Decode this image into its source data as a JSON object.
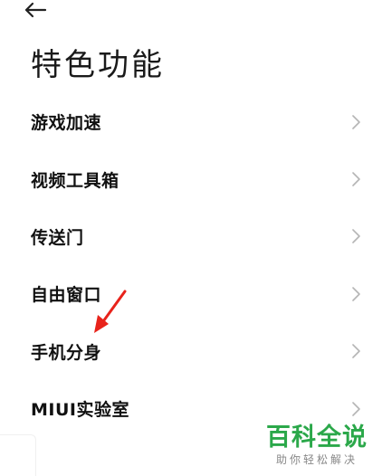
{
  "header": {
    "back_icon": "arrow-left-icon",
    "title": "特色功能"
  },
  "list": {
    "items": [
      {
        "label": "游戏加速",
        "icon": "chevron-right-icon"
      },
      {
        "label": "视频工具箱",
        "icon": "chevron-right-icon"
      },
      {
        "label": "传送门",
        "icon": "chevron-right-icon"
      },
      {
        "label": "自由窗口",
        "icon": "chevron-right-icon"
      },
      {
        "label": "手机分身",
        "icon": "chevron-right-icon"
      },
      {
        "label": "MIUI实验室",
        "icon": "chevron-right-icon"
      }
    ]
  },
  "annotation": {
    "arrow_color": "#e8231b",
    "target": "手机分身"
  },
  "watermark": {
    "logo": "百科全说",
    "slogan": "助你轻松解决",
    "color": "#2ba84a"
  }
}
